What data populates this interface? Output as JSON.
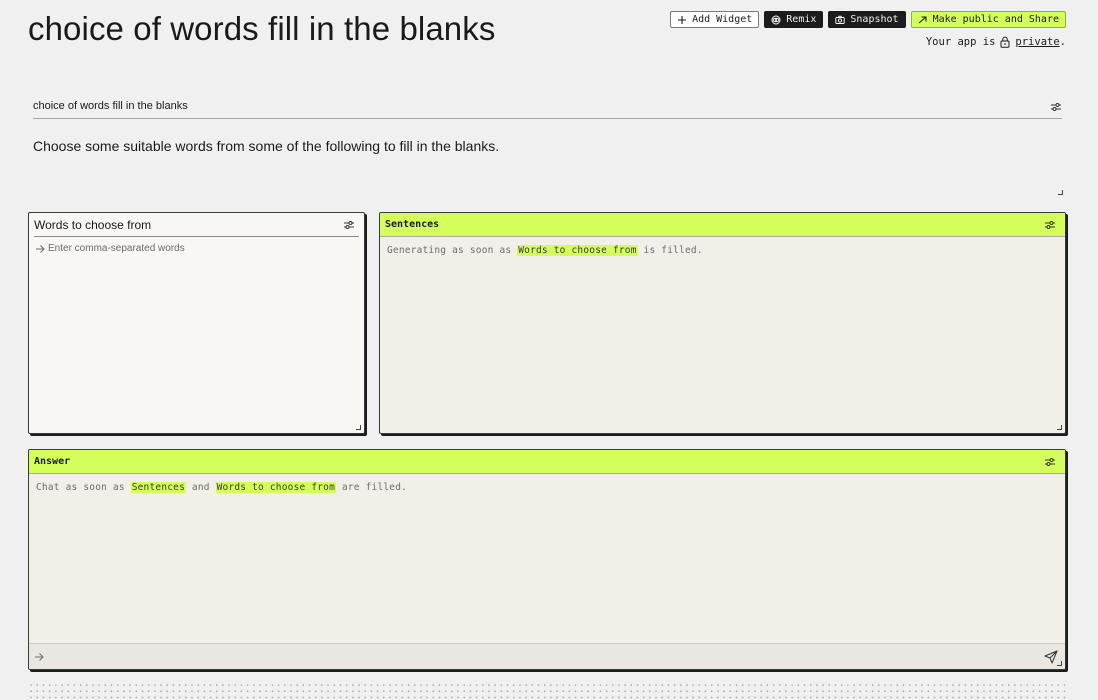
{
  "app": {
    "title": "choice of words fill in the blanks",
    "description": "Choose some suitable words from some of the following to fill in the blanks."
  },
  "toolbar": {
    "add_widget_label": "Add Widget",
    "remix_label": "Remix",
    "snapshot_label": "Snapshot",
    "share_label": "Make public and Share"
  },
  "privacy": {
    "prefix": "Your app is",
    "status": "private",
    "suffix": "."
  },
  "title_input": {
    "value": "choice of words fill in the blanks"
  },
  "words_panel": {
    "label": "Words to choose from",
    "placeholder": "Enter comma-separated words",
    "value": ""
  },
  "sentences_panel": {
    "label": "Sentences",
    "status_prefix": "Generating as soon as",
    "status_dep": "Words to choose from",
    "status_suffix": "is filled."
  },
  "answer_panel": {
    "label": "Answer",
    "status_prefix": "Chat as soon as",
    "status_dep1": "Sentences",
    "status_mid": "and",
    "status_dep2": "Words to choose from",
    "status_suffix": "are filled.",
    "chat_value": ""
  },
  "colors": {
    "accent": "#d4ff5a",
    "background": "#f0f0f0",
    "panel_bg": "#f2eee8",
    "dark_button": "#1c1c1c"
  }
}
